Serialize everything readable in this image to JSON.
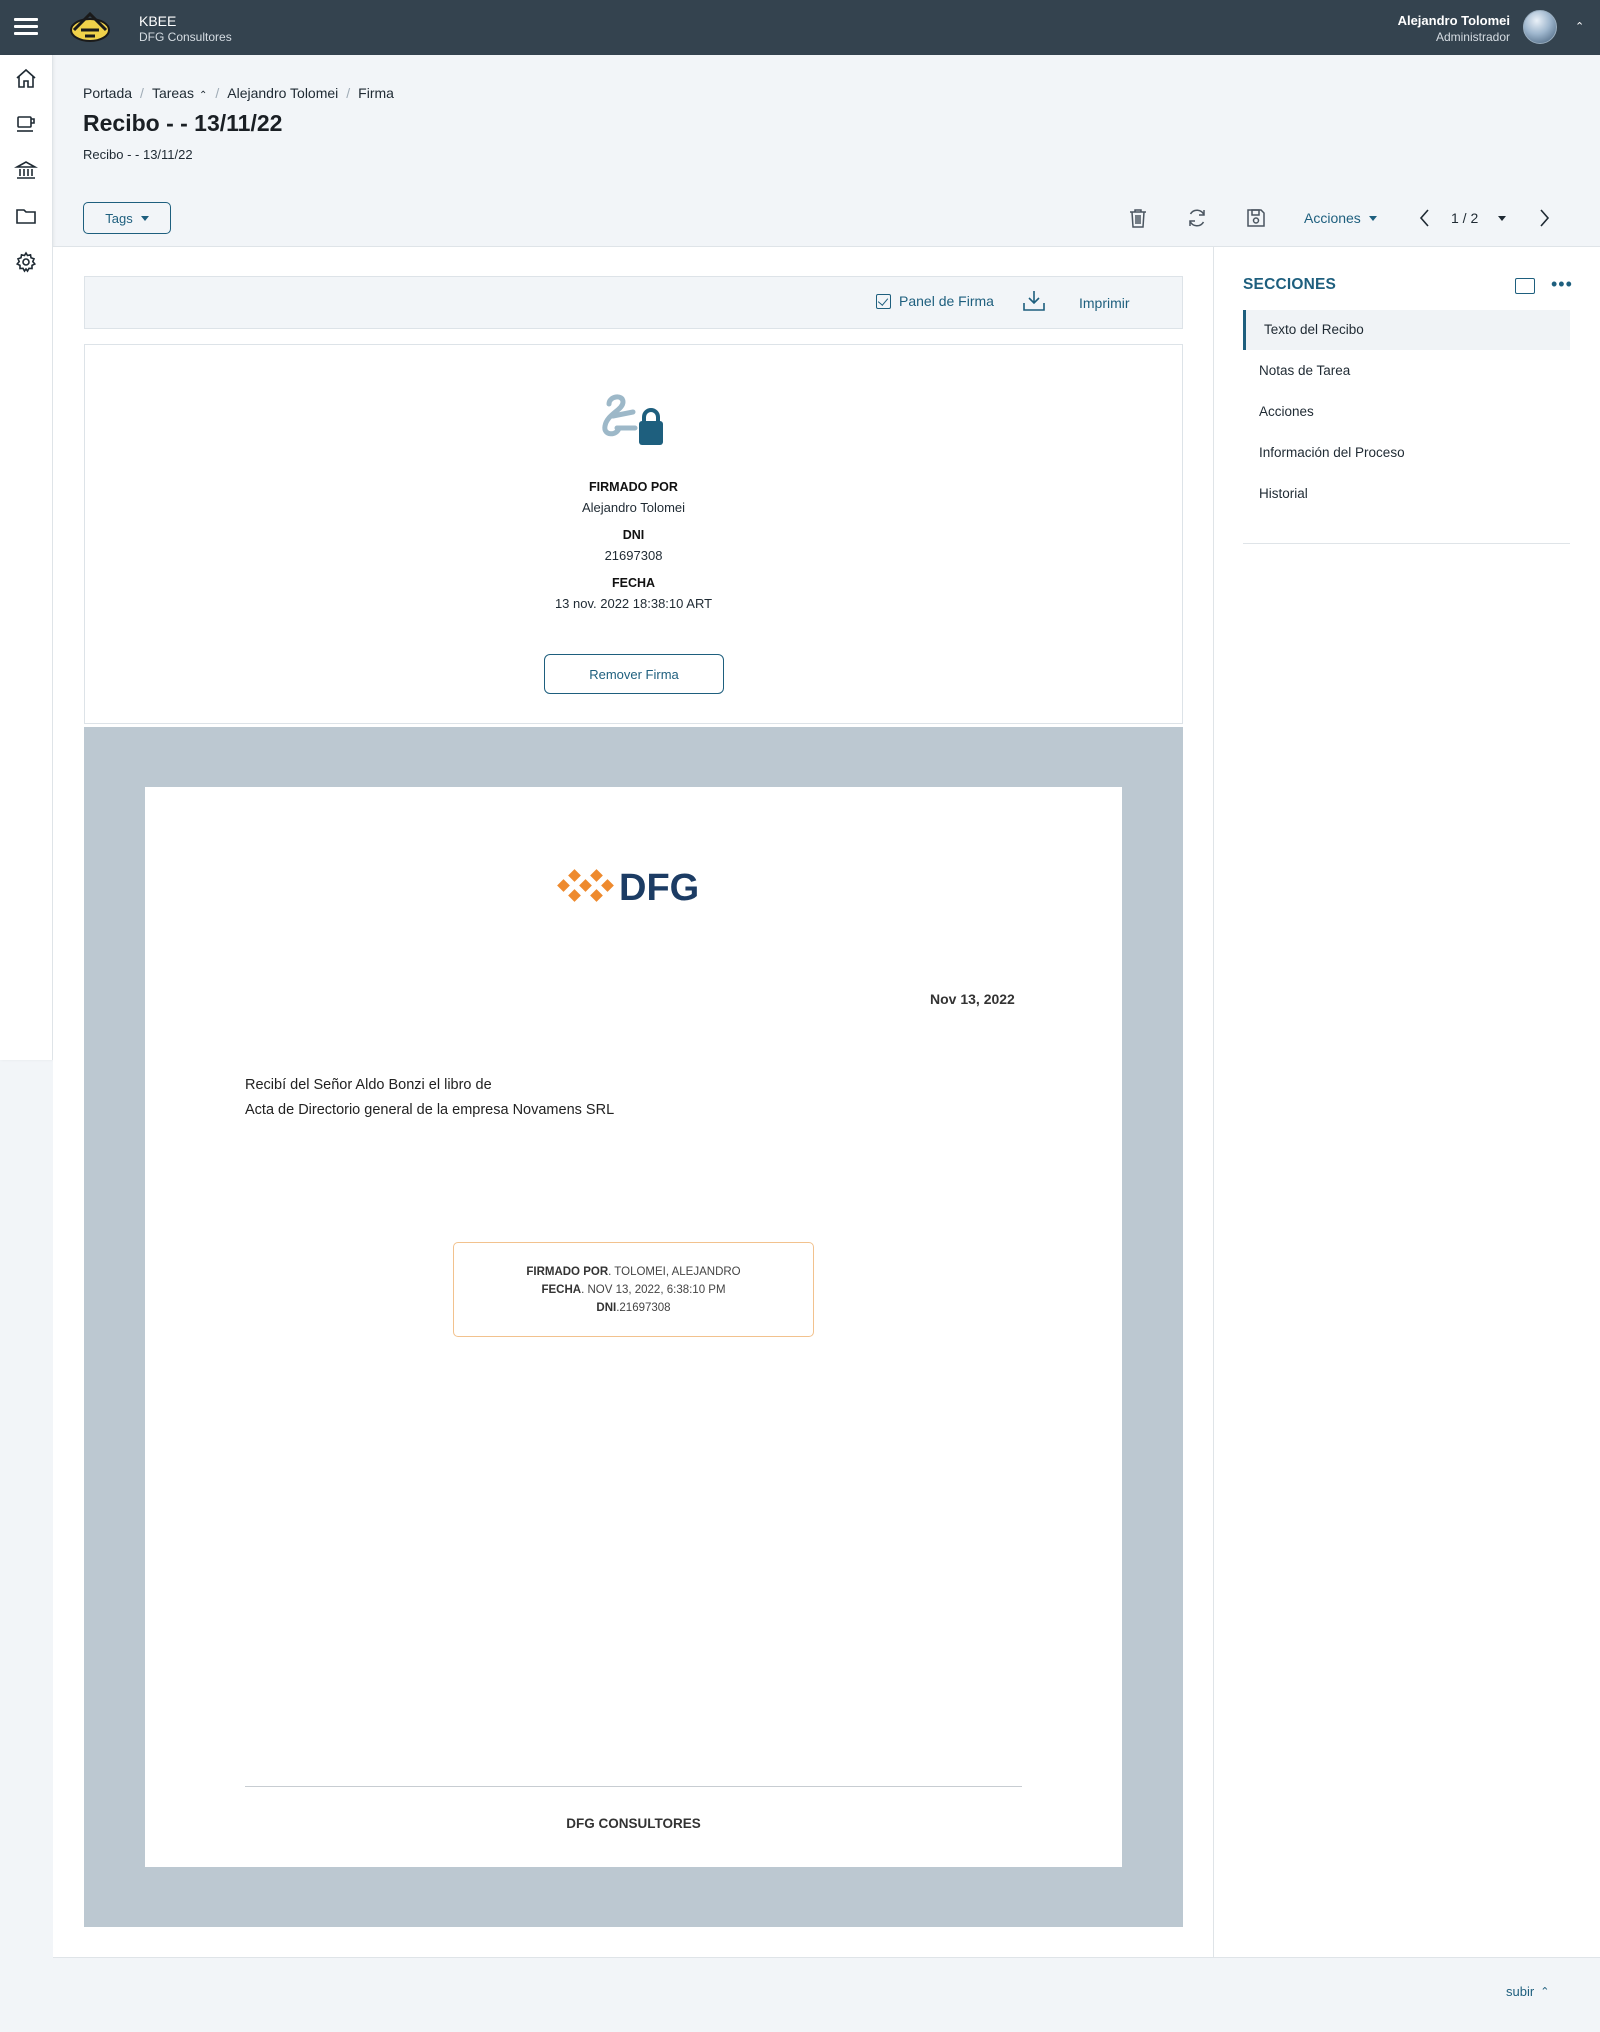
{
  "topbar": {
    "app_name": "KBEE",
    "company": "DFG Consultores",
    "user_name": "Alejandro Tolomei",
    "user_role": "Administrador"
  },
  "sidebar": {
    "icons": [
      "home-icon",
      "coffee-icon",
      "bank-icon",
      "folder-icon",
      "gear-icon"
    ]
  },
  "breadcrumb": {
    "items": [
      "Portada",
      "Tareas",
      "Alejandro Tolomei",
      "Firma"
    ],
    "separator": "/"
  },
  "page": {
    "title": "Recibo - - 13/11/22",
    "subtitle": "Recibo - - 13/11/22"
  },
  "toolbar": {
    "tags_label": "Tags",
    "acciones_label": "Acciones",
    "pager": "1 / 2",
    "icons": [
      "trash-icon",
      "refresh-icon",
      "save-icon"
    ]
  },
  "doc_toolbar": {
    "panel_firma_label": "Panel de Firma",
    "imprimir_label": "Imprimir"
  },
  "signature": {
    "signed_by_label": "FIRMADO POR",
    "signed_by": "Alejandro Tolomei",
    "dni_label": "DNI",
    "dni": "21697308",
    "date_label": "FECHA",
    "date": "13 nov. 2022 18:38:10 ART",
    "remove_label": "Remover Firma"
  },
  "document": {
    "logo_text": "DFG",
    "date": "Nov 13, 2022",
    "body_line1": "Recibí del Señor Aldo Bonzi el libro de",
    "body_line2": "Acta de Directorio general de la empresa Novamens SRL",
    "stamp": {
      "line1_label": "FIRMADO POR",
      "line1_value": ". TOLOMEI, ALEJANDRO",
      "line2_label": "FECHA",
      "line2_value": ". NOV 13, 2022, 6:38:10 PM",
      "line3_label": "DNI",
      "line3_value": ".21697308"
    },
    "footer": "DFG CONSULTORES"
  },
  "sections": {
    "title": "SECCIONES",
    "items": [
      "Texto del Recibo",
      "Notas de Tarea",
      "Acciones",
      "Información del Proceso",
      "Historial"
    ],
    "active_index": 0
  },
  "footer": {
    "subir_label": "subir"
  },
  "colors": {
    "topbar": "#34434f",
    "accent": "#1e5f7e",
    "logo_orange": "#ee8a2e",
    "logo_navy": "#1c3c64"
  }
}
